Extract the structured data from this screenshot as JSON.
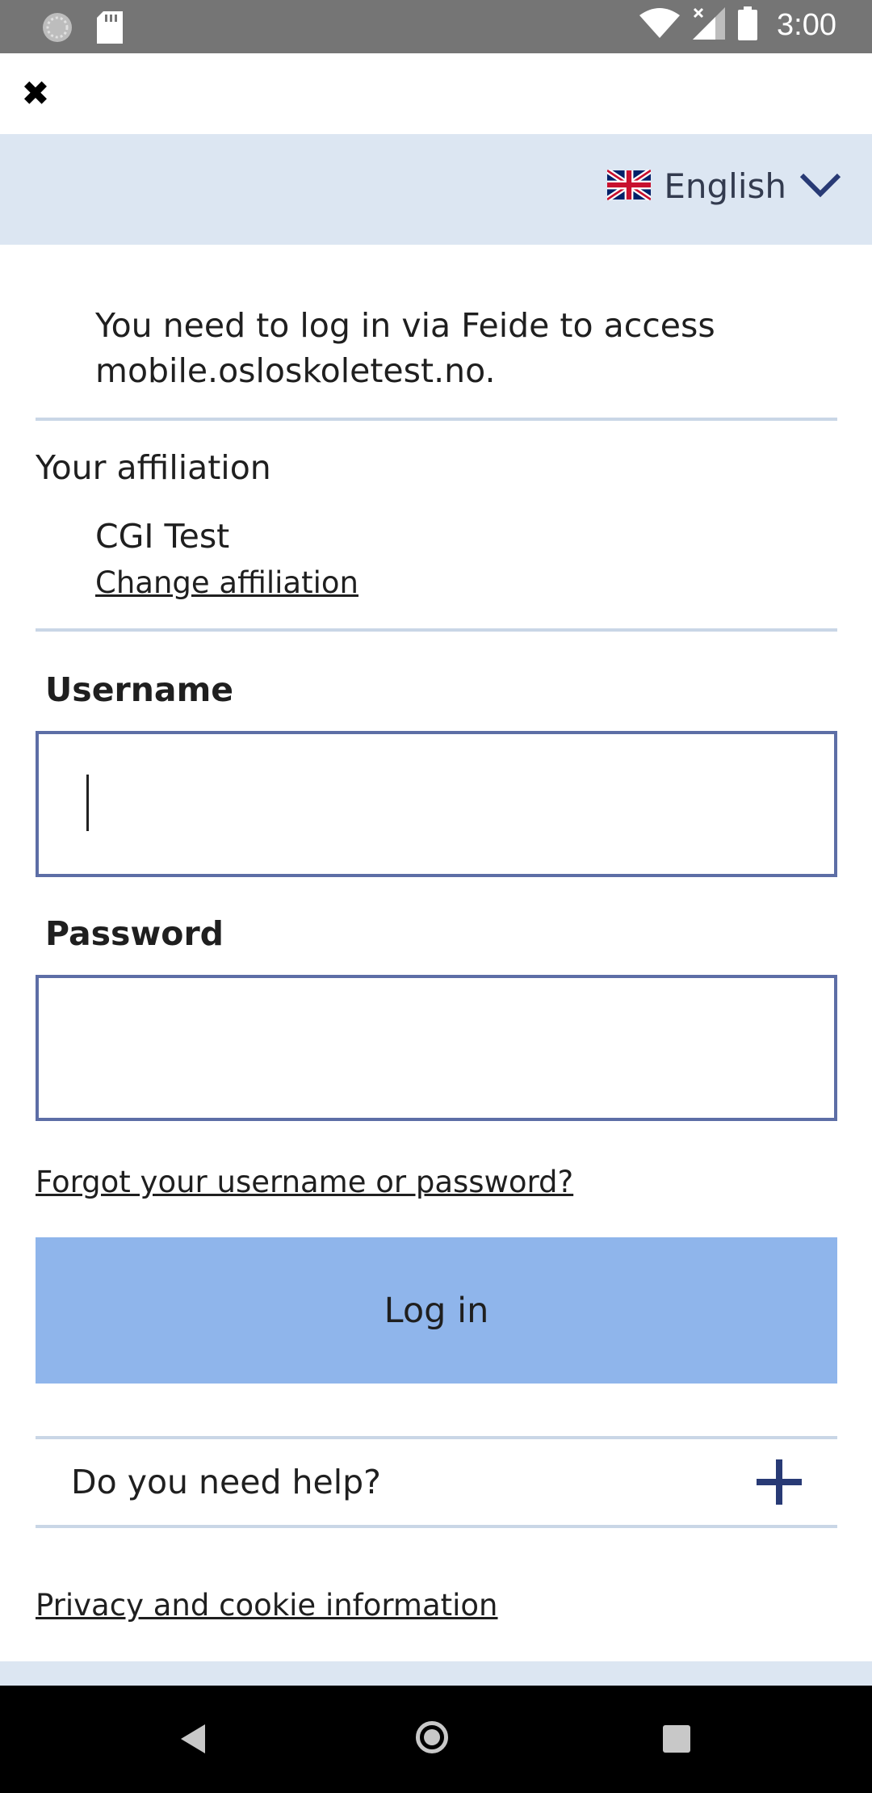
{
  "status_bar": {
    "time": "3:00",
    "icons": [
      "sync-icon",
      "sd-card-icon",
      "wifi-icon",
      "signal-icon",
      "battery-icon"
    ]
  },
  "top_bar": {
    "close_icon": "close-icon"
  },
  "language": {
    "label": "English",
    "flag": "uk-flag-icon"
  },
  "intro": {
    "text": "You need to log in via Feide to access mobile.osloskoletest.no."
  },
  "affiliation": {
    "title": "Your affiliation",
    "name": "CGI Test",
    "change_label": "Change affiliation"
  },
  "form": {
    "username_label": "Username",
    "username_value": "",
    "password_label": "Password",
    "password_value": "",
    "forgot_label": "Forgot your username or password?",
    "login_label": "Log in"
  },
  "help": {
    "label": "Do you need help?"
  },
  "footer": {
    "privacy_label": "Privacy and cookie information"
  },
  "colors": {
    "status_bar": "#757575",
    "lang_bar": "#dce6f2",
    "field_border": "#5d6ea6",
    "login_button": "#8fb5eb",
    "divider": "#c9d6e6",
    "accent": "#283a75"
  }
}
